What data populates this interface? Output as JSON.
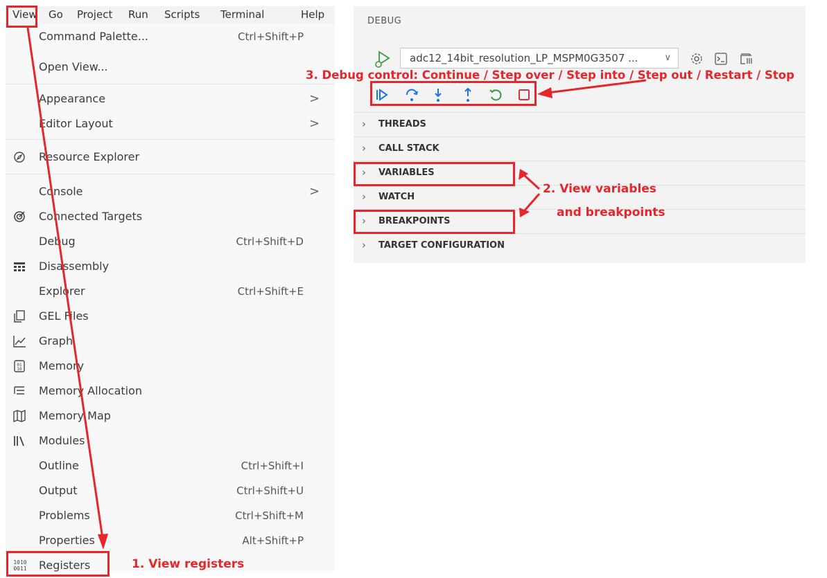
{
  "menubar": {
    "items": [
      "View",
      "Go",
      "Project",
      "Run",
      "Scripts",
      "Terminal",
      "Help"
    ]
  },
  "menu": {
    "items": [
      {
        "label": "Command Palette...",
        "shortcut": "Ctrl+Shift+P"
      },
      {
        "label": "Open View..."
      },
      {
        "label": "Appearance",
        "submenu": ">"
      },
      {
        "label": "Editor Layout",
        "submenu": ">"
      },
      {
        "label": "Resource Explorer",
        "icon": "compass-icon"
      },
      {
        "label": "Console",
        "submenu": ">"
      },
      {
        "label": "Connected Targets",
        "icon": "target-icon"
      },
      {
        "label": "Debug",
        "shortcut": "Ctrl+Shift+D"
      },
      {
        "label": "Disassembly",
        "icon": "disassembly-icon"
      },
      {
        "label": "Explorer",
        "shortcut": "Ctrl+Shift+E"
      },
      {
        "label": "GEL Files",
        "icon": "files-icon"
      },
      {
        "label": "Graph",
        "icon": "graph-icon"
      },
      {
        "label": "Memory",
        "icon": "memory-icon"
      },
      {
        "label": "Memory Allocation",
        "icon": "list-tree-icon"
      },
      {
        "label": "Memory Map",
        "icon": "map-icon"
      },
      {
        "label": "Modules",
        "icon": "library-icon"
      },
      {
        "label": "Outline",
        "shortcut": "Ctrl+Shift+I"
      },
      {
        "label": "Output",
        "shortcut": "Ctrl+Shift+U"
      },
      {
        "label": "Problems",
        "shortcut": "Ctrl+Shift+M"
      },
      {
        "label": "Properties",
        "shortcut": "Alt+Shift+P"
      },
      {
        "label": "Registers",
        "icon": "binary-icon"
      }
    ]
  },
  "debug": {
    "title": "DEBUG",
    "config": "adc12_14bit_resolution_LP_MSPM0G3507 ...",
    "sections": [
      "THREADS",
      "CALL STACK",
      "VARIABLES",
      "WATCH",
      "BREAKPOINTS",
      "TARGET CONFIGURATION"
    ]
  },
  "annotations": {
    "registers": "1. View registers",
    "vars_line1": "2. View variables",
    "vars_line2": "and breakpoints",
    "debug_control": "3. Debug control: Continue / Step over / Step into / Step out / Restart / Stop"
  },
  "colors": {
    "annotation": "#e5262b",
    "debug_blue": "#1a73e8",
    "restart_green": "#3c9a3c",
    "stop_red": "#d13438"
  }
}
